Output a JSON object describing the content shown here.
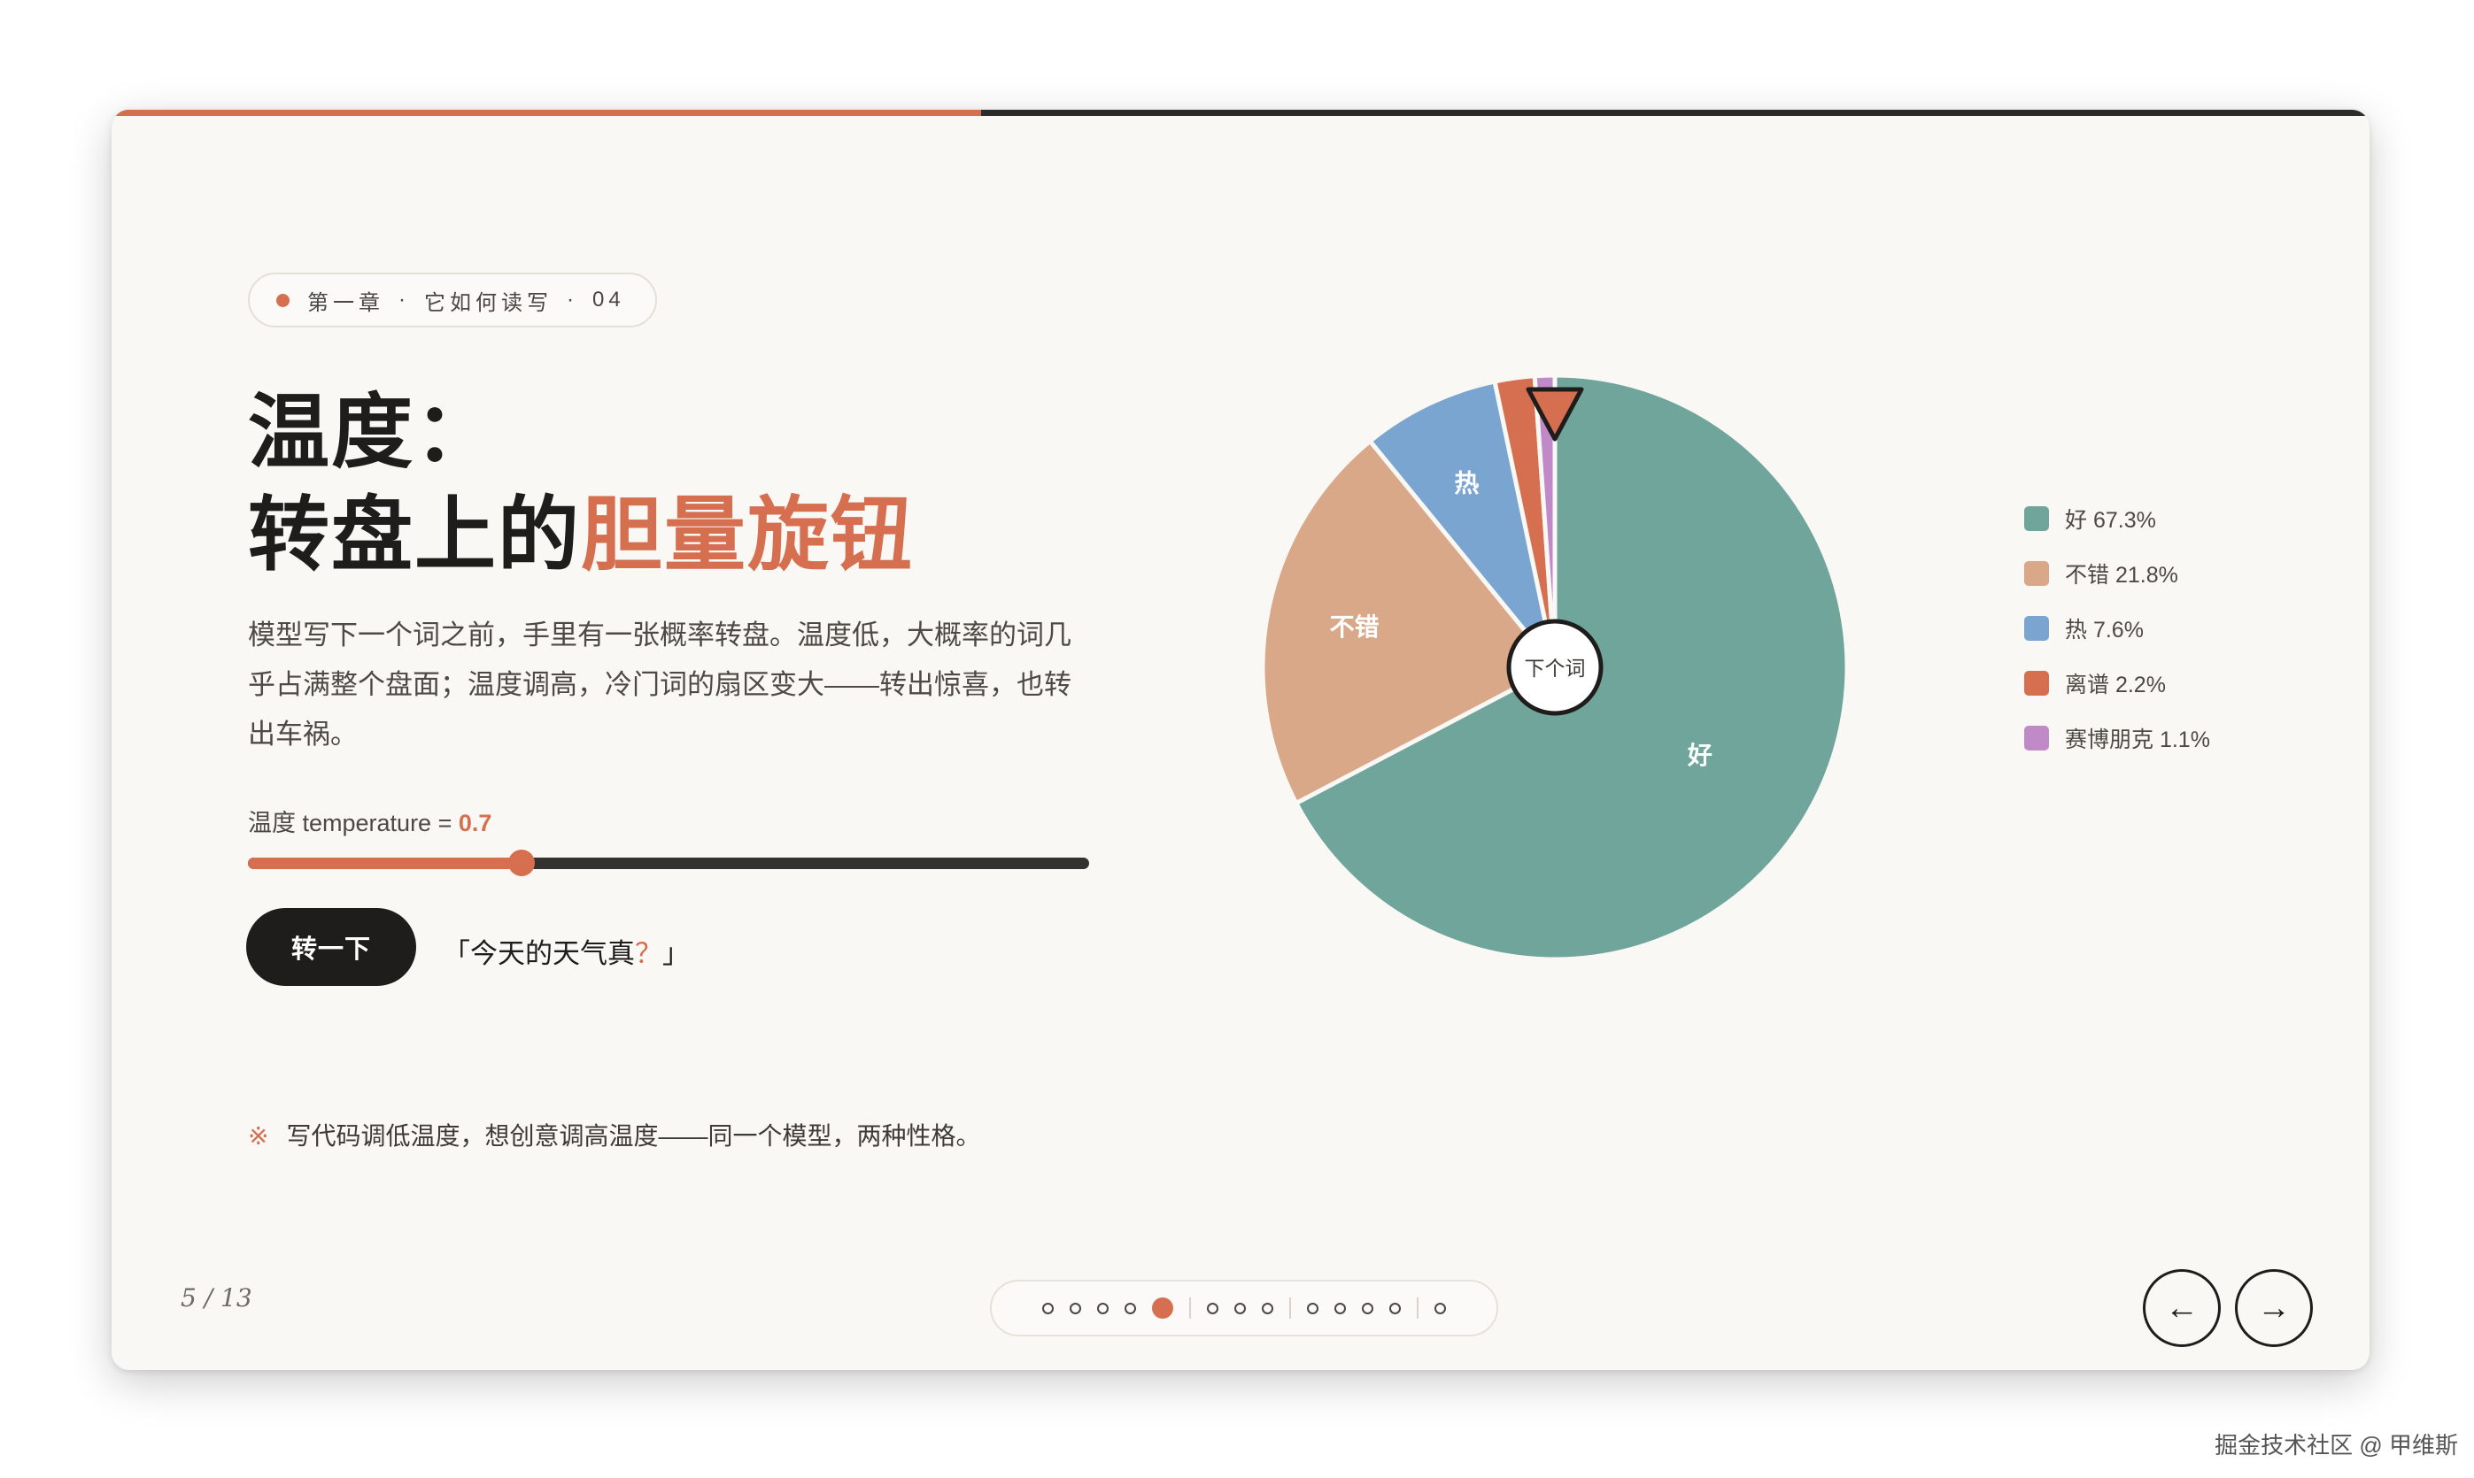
{
  "progress": {
    "fraction": 0.385
  },
  "chapter": {
    "label": "第一章",
    "sep": "·",
    "section": "它如何读写",
    "number": "04"
  },
  "title": {
    "line1": "温度：",
    "line2_prefix": "转盘上的",
    "line2_accent": "胆量旋钮"
  },
  "description": "模型写下一个词之前，手里有一张概率转盘。温度低，大概率的词几乎占满整个盘面；温度调高，冷门词的扇区变大——转出惊喜，也转出车祸。",
  "temperature": {
    "label": "温度 temperature = ",
    "value": "0.7",
    "fraction": 0.325
  },
  "spin_button": "转一下",
  "prompt": {
    "open": "「今天的天气真",
    "placeholder": "？",
    "close": "」"
  },
  "note": {
    "mark": "※",
    "text": "写代码调低温度，想创意调高温度——同一个模型，两种性格。"
  },
  "pagination": {
    "current": "5 / 13",
    "total_dots": 13,
    "active_index": 4,
    "separators_after": [
      4,
      7,
      11
    ]
  },
  "nav": {
    "prev_icon": "←",
    "next_icon": "→"
  },
  "chart_data": {
    "type": "pie",
    "center_label": "下个词",
    "slices": [
      {
        "label": "好",
        "value": 67.3,
        "color": "#70a59b",
        "legend": "好 67.3%"
      },
      {
        "label": "不错",
        "value": 21.8,
        "color": "#d8a888",
        "legend": "不错 21.8%"
      },
      {
        "label": "热",
        "value": 7.6,
        "color": "#7aa5d1",
        "legend": "热 7.6%"
      },
      {
        "label": "离谱",
        "value": 2.2,
        "color": "#d66f50",
        "legend": "离谱 2.2%"
      },
      {
        "label": "赛博朋克",
        "value": 1.1,
        "color": "#c08ac9",
        "legend": "赛博朋克 1.1%"
      }
    ],
    "pointer_color": "#d66f50"
  },
  "watermark": "掘金技术社区 @ 甲维斯"
}
